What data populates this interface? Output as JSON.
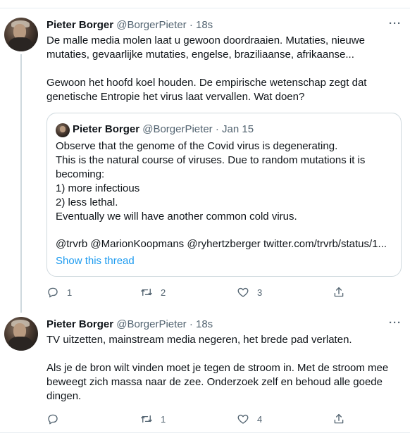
{
  "tweets": [
    {
      "author_name": "Pieter Borger",
      "author_handle": "@BorgerPieter",
      "separator": "·",
      "time": "18s",
      "more": "···",
      "text": "De malle media molen laat u gewoon doordraaien. Mutaties, nieuwe mutaties, gevaarlijke mutaties, engelse, braziliaanse, afrikaanse...\n\nGewoon het hoofd koel houden. De empirische wetenschap zegt dat genetische Entropie het virus laat vervallen. Wat doen?",
      "quote": {
        "author_name": "Pieter Borger",
        "author_handle": "@BorgerPieter",
        "separator": "·",
        "time": "Jan 15",
        "text": "Observe that the genome of the Covid virus is degenerating.\nThis is the natural course of viruses. Due to random mutations it is becoming:\n1) more infectious\n2) less lethal.\nEventually we will have another common cold virus.",
        "links": "@trvrb @MarionKoopmans @ryhertzberger twitter.com/trvrb/status/1...",
        "show_thread": "Show this thread"
      },
      "actions": {
        "replies": "1",
        "retweets": "2",
        "likes": "3"
      }
    },
    {
      "author_name": "Pieter Borger",
      "author_handle": "@BorgerPieter",
      "separator": "·",
      "time": "18s",
      "more": "···",
      "text": "TV uitzetten, mainstream media negeren, het brede pad verlaten.\n\nAls je de bron wilt vinden moet je tegen de stroom in. Met de stroom mee beweegt zich massa naar de zee. Onderzoek zelf en behoud alle goede dingen.",
      "actions": {
        "replies": "",
        "retweets": "1",
        "likes": "4"
      }
    }
  ],
  "icons": {
    "reply": "reply-icon",
    "retweet": "retweet-icon",
    "like": "heart-icon",
    "share": "share-icon",
    "more": "more-icon"
  },
  "colors": {
    "link": "#1d9bf0",
    "secondary_text": "#536471",
    "border": "#cfd9de"
  }
}
